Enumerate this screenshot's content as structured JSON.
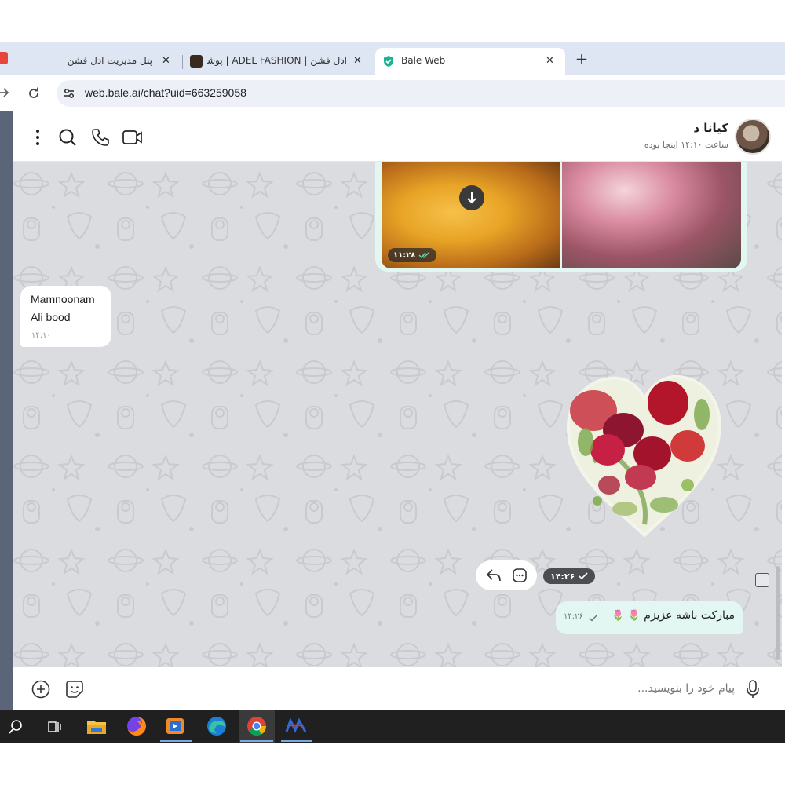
{
  "browser": {
    "tabs": [
      {
        "label": "پنل مدیریت ادل فشن"
      },
      {
        "label": "ادل فشن | ADEL FASHION | پوشا"
      },
      {
        "label": "Bale Web"
      }
    ],
    "close_glyph": "✕",
    "new_tab_glyph": "+",
    "url": "web.bale.ai/chat?uid=663259058"
  },
  "chat": {
    "contact_name": "کیانا د",
    "contact_status": "ساعت ۱۴:۱۰ اینجا بوده",
    "messages": [
      {
        "type": "album",
        "time": "۱۱:۲۸",
        "direction": "outgoing"
      },
      {
        "type": "text",
        "direction": "incoming",
        "lines": [
          "Mamnoonam",
          "Ali bood"
        ],
        "time": "۱۴:۱۰"
      },
      {
        "type": "sticker",
        "direction": "outgoing",
        "time": "۱۴:۲۶",
        "sticker": "heart-of-flowers"
      },
      {
        "type": "text",
        "direction": "outgoing",
        "text": "مبارکت باشه عزیزم",
        "emoji": "🌷 🌷",
        "time": "۱۴:۲۶"
      }
    ],
    "composer": {
      "placeholder": "پیام خود را بنویسید..."
    }
  },
  "colors": {
    "chat_background": "#dadce0",
    "outgoing_bubble": "#e3f7f2",
    "incoming_bubble": "#ffffff",
    "taskbar": "#202020",
    "accent": "#1a9e8a"
  },
  "icons": [
    "more-vert-icon",
    "search-icon",
    "phone-icon",
    "video-icon",
    "download-icon",
    "reply-icon",
    "more-options-icon",
    "add-icon",
    "sticker-icon",
    "mic-icon",
    "checkmark-icon",
    "double-check-icon"
  ]
}
